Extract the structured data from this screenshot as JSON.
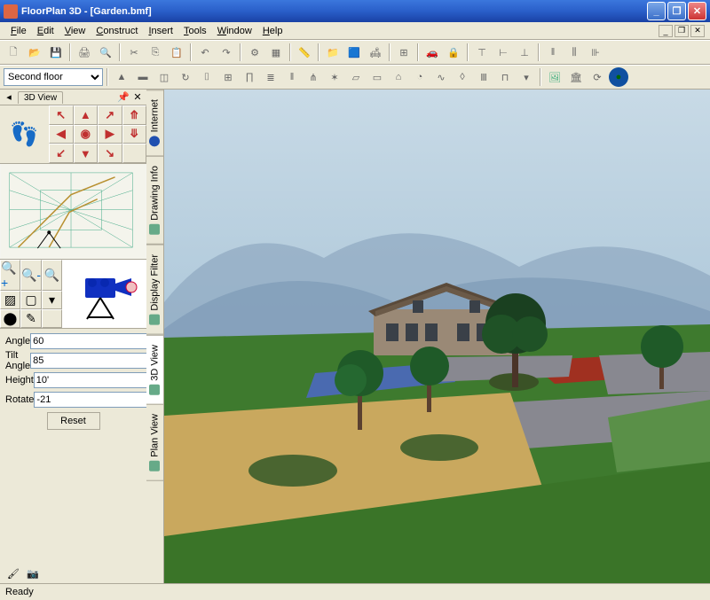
{
  "window": {
    "title": "FloorPlan 3D - [Garden.bmf]"
  },
  "menu": {
    "file": "File",
    "edit": "Edit",
    "view": "View",
    "construct": "Construct",
    "insert": "Insert",
    "tools": "Tools",
    "window": "Window",
    "help": "Help"
  },
  "toolbar2": {
    "floor_select": "Second floor"
  },
  "left": {
    "tab_3dview": "3D View",
    "angle_label": "Angle",
    "tilt_label": "Tilt Angle",
    "height_label": "Height",
    "rotate_label": "Rotate",
    "angle_val": "60",
    "tilt_val": "85",
    "height_val": "10'",
    "rotate_val": "-21",
    "reset": "Reset"
  },
  "sidetabs": {
    "internet": "Internet",
    "drawing_info": "Drawing Info",
    "display_filter": "Display Filter",
    "view3d": "3D View",
    "plan_view": "Plan View"
  },
  "status": {
    "text": "Ready"
  }
}
